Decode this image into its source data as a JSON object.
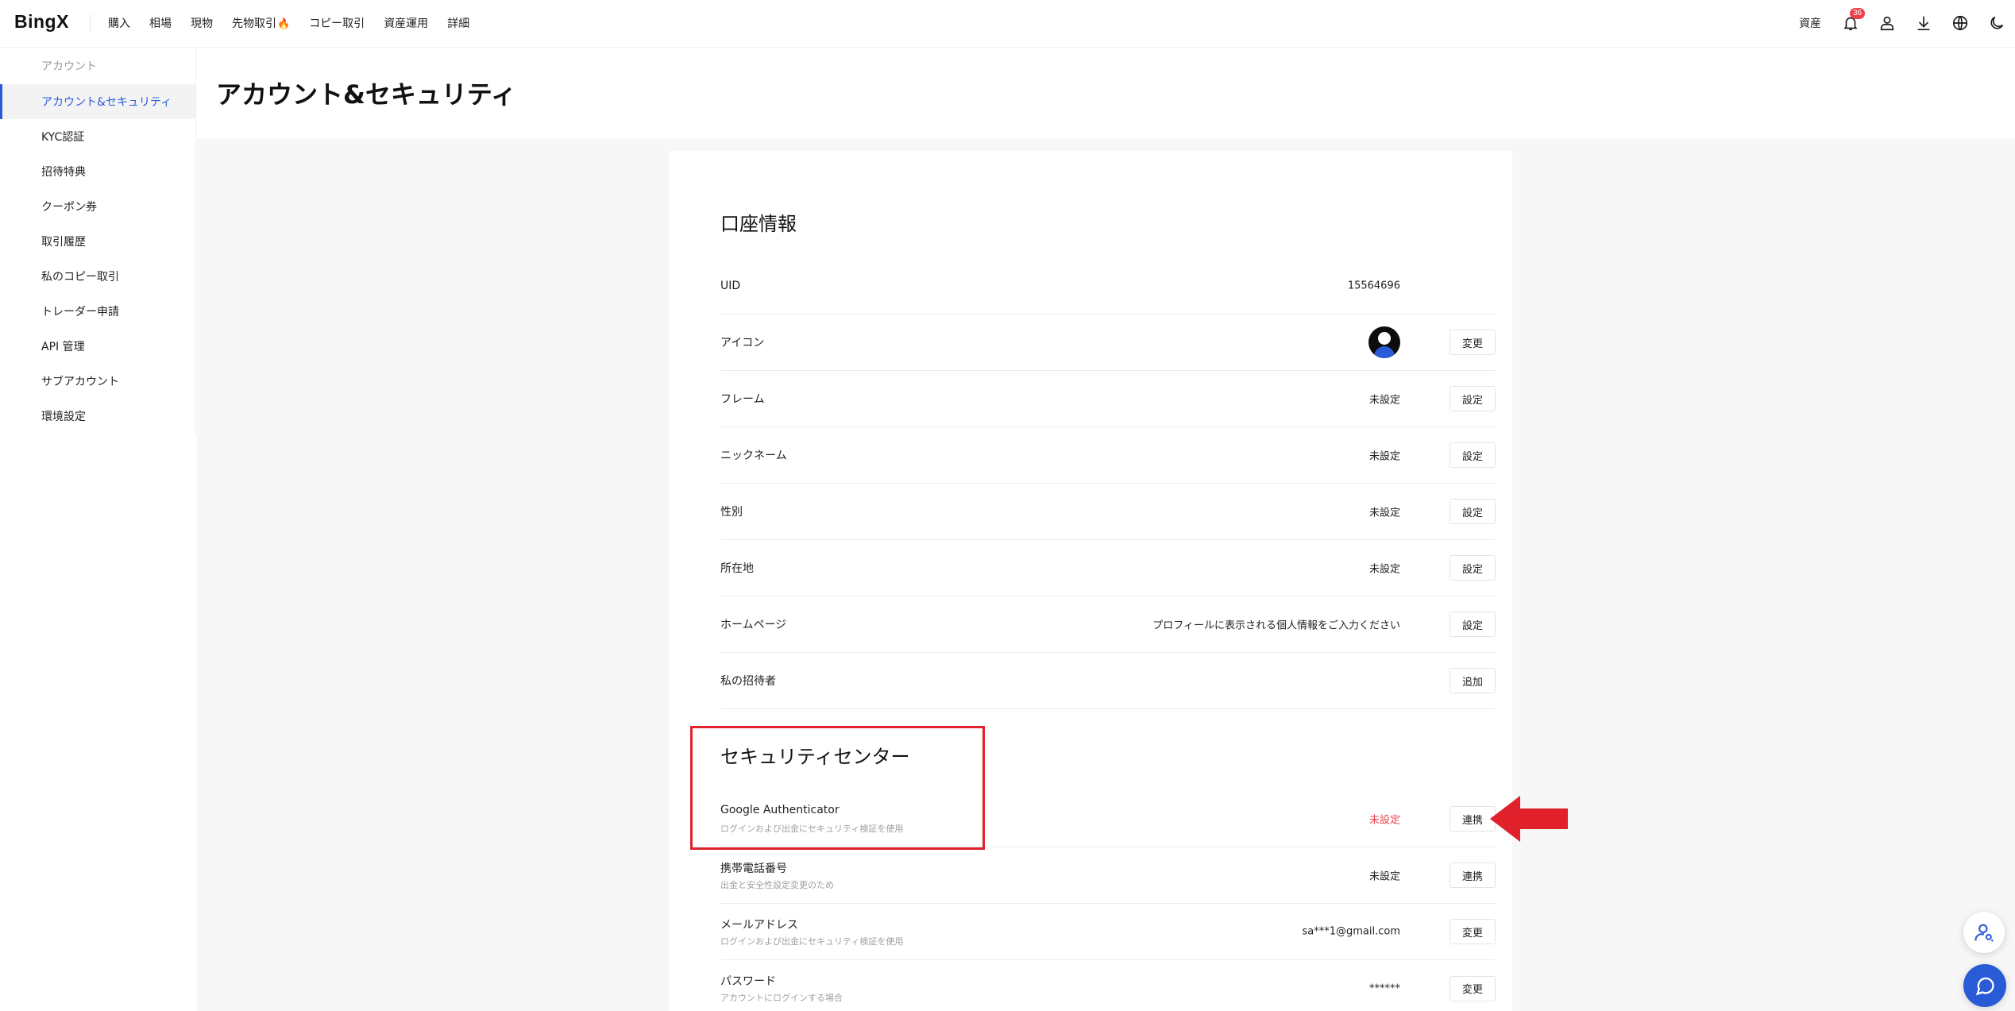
{
  "brand": {
    "logo": "BingX"
  },
  "nav": {
    "items": [
      "購入",
      "相場",
      "現物",
      "先物取引",
      "コピー取引",
      "資産運用",
      "詳細"
    ],
    "fire_icon": "fire-icon",
    "assets_label": "資産",
    "notification_count": "36"
  },
  "sidebar": {
    "header": "アカウント",
    "items": [
      {
        "label": "アカウント&セキュリティ",
        "active": true
      },
      {
        "label": "KYC認証"
      },
      {
        "label": "招待特典"
      },
      {
        "label": "クーポン券"
      },
      {
        "label": "取引履歴"
      },
      {
        "label": "私のコピー取引"
      },
      {
        "label": "トレーダー申請"
      },
      {
        "label": "API 管理"
      },
      {
        "label": "サブアカウント"
      },
      {
        "label": "環境設定"
      }
    ]
  },
  "page": {
    "title": "アカウント&セキュリティ"
  },
  "account_info": {
    "title": "口座情報",
    "rows": [
      {
        "label": "UID",
        "value": "15564696",
        "button": ""
      },
      {
        "label": "アイコン",
        "value": "",
        "button": "変更"
      },
      {
        "label": "フレーム",
        "value": "未設定",
        "button": "設定"
      },
      {
        "label": "ニックネーム",
        "value": "未設定",
        "button": "設定"
      },
      {
        "label": "性別",
        "value": "未設定",
        "button": "設定"
      },
      {
        "label": "所在地",
        "value": "未設定",
        "button": "設定"
      },
      {
        "label": "ホームページ",
        "value": "プロフィールに表示される個人情報をご入力ください",
        "button": "設定"
      },
      {
        "label": "私の招待者",
        "value": "",
        "button": "追加"
      }
    ]
  },
  "security_center": {
    "title": "セキュリティセンター",
    "rows": [
      {
        "label": "Google Authenticator",
        "sub": "ログインおよび出金にセキュリティ検証を使用",
        "value": "未設定",
        "button": "連携"
      },
      {
        "label": "携帯電話番号",
        "sub": "出金と安全性設定変更のため",
        "value": "未設定",
        "button": "連携"
      },
      {
        "label": "メールアドレス",
        "sub": "ログインおよび出金にセキュリティ検証を使用",
        "value": "sa***1@gmail.com",
        "button": "変更"
      },
      {
        "label": "パスワード",
        "sub": "アカウントにログインする場合",
        "value": "******",
        "button": "変更"
      }
    ]
  },
  "colors": {
    "accent": "#2a5bd7",
    "highlight": "#e0202a",
    "unset_red": "#f0414b"
  }
}
